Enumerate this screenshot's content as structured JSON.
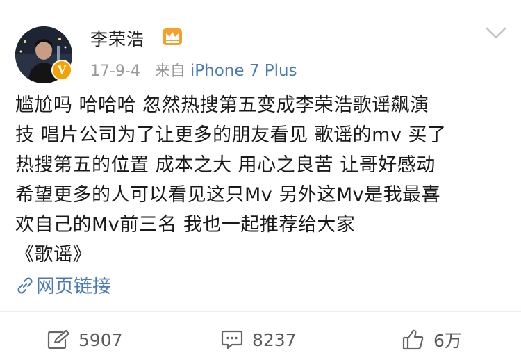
{
  "post": {
    "author": "李荣浩",
    "date": "17-9-4",
    "source_prefix": "来自",
    "source_device": "iPhone 7 Plus",
    "verified_badge": "V",
    "content_lines": [
      "尴尬吗 哈哈哈 忽然热搜第五变成李荣浩歌谣飙演",
      "技 唱片公司为了让更多的朋友看见 歌谣的mv 买了",
      "热搜第五的位置 成本之大 用心之良苦 让哥好感动",
      "希望更多的人可以看见这只Mv 另外这Mv是我最喜",
      "欢自己的Mv前三名 我也一起推荐给大家",
      "《歌谣》"
    ],
    "link_label": "网页链接"
  },
  "actions": {
    "reposts": "5907",
    "comments": "8237",
    "likes": "6万"
  },
  "icons": {
    "crown": "crown-icon",
    "chevron": "chevron-down-icon",
    "link": "link-icon",
    "repost": "repost-icon",
    "comment": "comment-icon",
    "like": "thumbs-up-icon"
  },
  "colors": {
    "link_blue": "#4a7bb8",
    "meta_gray": "#9a9a9a",
    "badge_orange": "#f5a100",
    "crown_orange": "#f2a02e"
  }
}
